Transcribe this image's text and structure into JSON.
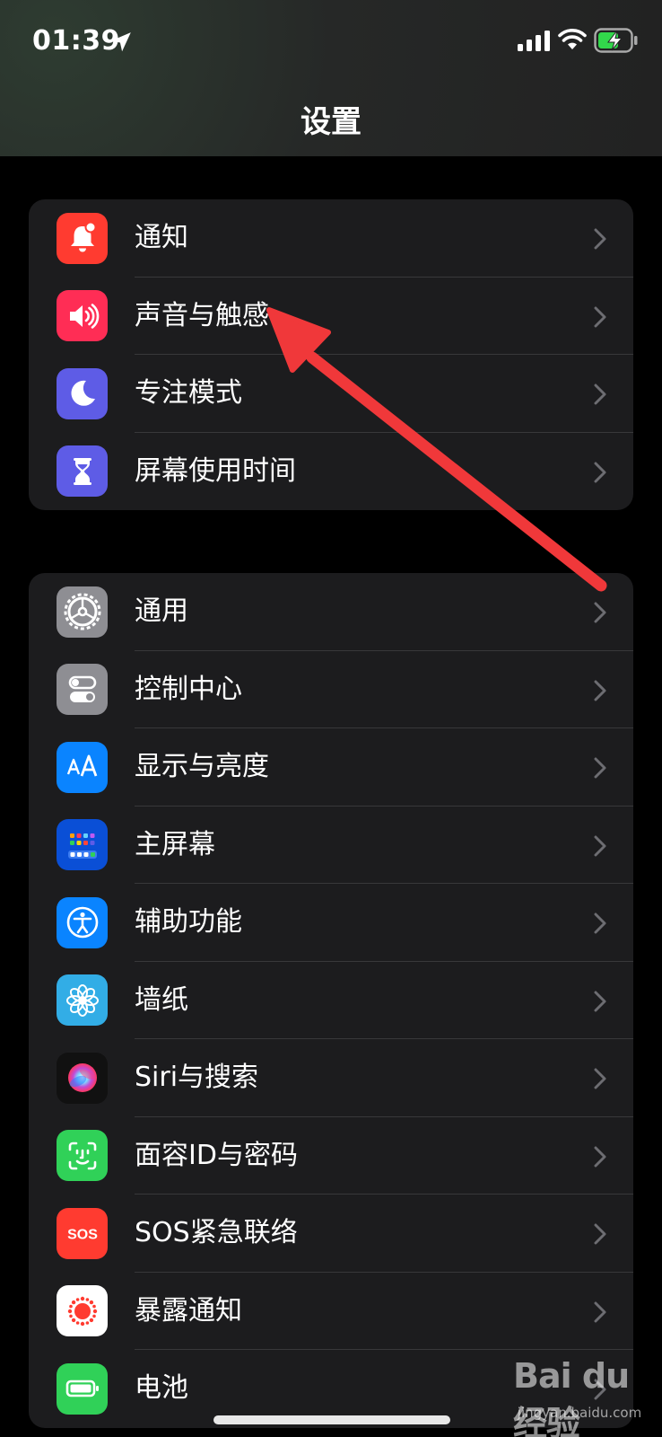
{
  "status": {
    "time": "01:39"
  },
  "header": {
    "title": "设置"
  },
  "groups": [
    {
      "items": [
        {
          "label": "通知",
          "icon": "bell-icon",
          "color": "#ff3b30"
        },
        {
          "label": "声音与触感",
          "icon": "speaker-icon",
          "color": "#ff2d55"
        },
        {
          "label": "专注模式",
          "icon": "moon-icon",
          "color": "#5e5ce6"
        },
        {
          "label": "屏幕使用时间",
          "icon": "hourglass-icon",
          "color": "#5e5ce6"
        }
      ]
    },
    {
      "items": [
        {
          "label": "通用",
          "icon": "gear-icon",
          "color": "#8e8e93"
        },
        {
          "label": "控制中心",
          "icon": "toggles-icon",
          "color": "#8e8e93"
        },
        {
          "label": "显示与亮度",
          "icon": "text-size-icon",
          "color": "#0a84ff"
        },
        {
          "label": "主屏幕",
          "icon": "home-grid-icon",
          "color": "#0a4fd6"
        },
        {
          "label": "辅助功能",
          "icon": "accessibility-icon",
          "color": "#0a84ff"
        },
        {
          "label": "墙纸",
          "icon": "flower-icon",
          "color": "#32ade6"
        },
        {
          "label": "Siri与搜索",
          "icon": "siri-icon",
          "color": "#111111"
        },
        {
          "label": "面容ID与密码",
          "icon": "face-id-icon",
          "color": "#30d158"
        },
        {
          "label": "SOS紧急联络",
          "icon": "sos-icon",
          "color": "#ff3b30"
        },
        {
          "label": "暴露通知",
          "icon": "exposure-icon",
          "color": "#ffffff"
        },
        {
          "label": "电池",
          "icon": "battery-icon",
          "color": "#30d158"
        }
      ]
    }
  ],
  "watermark": {
    "text": "Bai du 经验",
    "sub": "jingyan.baidu.com"
  },
  "colors": {
    "arrow": "#f0383a",
    "group_bg": "#1c1c1e",
    "separator": "#38383a"
  }
}
